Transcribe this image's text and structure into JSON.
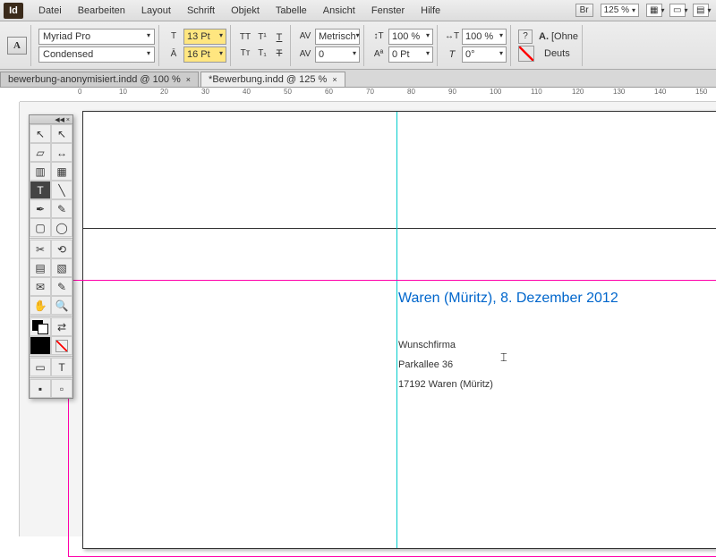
{
  "app": {
    "logo": "Id"
  },
  "menu": [
    "Datei",
    "Bearbeiten",
    "Layout",
    "Schrift",
    "Objekt",
    "Tabelle",
    "Ansicht",
    "Fenster",
    "Hilfe"
  ],
  "zoom_label": "125 %",
  "br_label": "Br",
  "control": {
    "font": "Myriad Pro",
    "style": "Condensed",
    "size": "13 Pt",
    "leading": "16 Pt",
    "kerning": "Metrisch",
    "tracking": "0",
    "vscale": "100 %",
    "hscale": "100 %",
    "baseline": "0 Pt",
    "skew": "0°",
    "lang": "Deuts",
    "ohne": "[Ohne"
  },
  "tabs": [
    {
      "label": "bewerbung-anonymisiert.indd @ 100 %",
      "active": false
    },
    {
      "label": "*Bewerbung.indd @ 125 %",
      "active": true
    }
  ],
  "ruler_marks": [
    0,
    10,
    20,
    30,
    40,
    50,
    60,
    70,
    80,
    90,
    100,
    110,
    120,
    130,
    140,
    150
  ],
  "document": {
    "date": "Waren (Müritz), 8. Dezember 2012",
    "line1": "Wunschfirma",
    "line2": "Parkallee 36",
    "line3": "17192 Waren (Müritz)"
  }
}
